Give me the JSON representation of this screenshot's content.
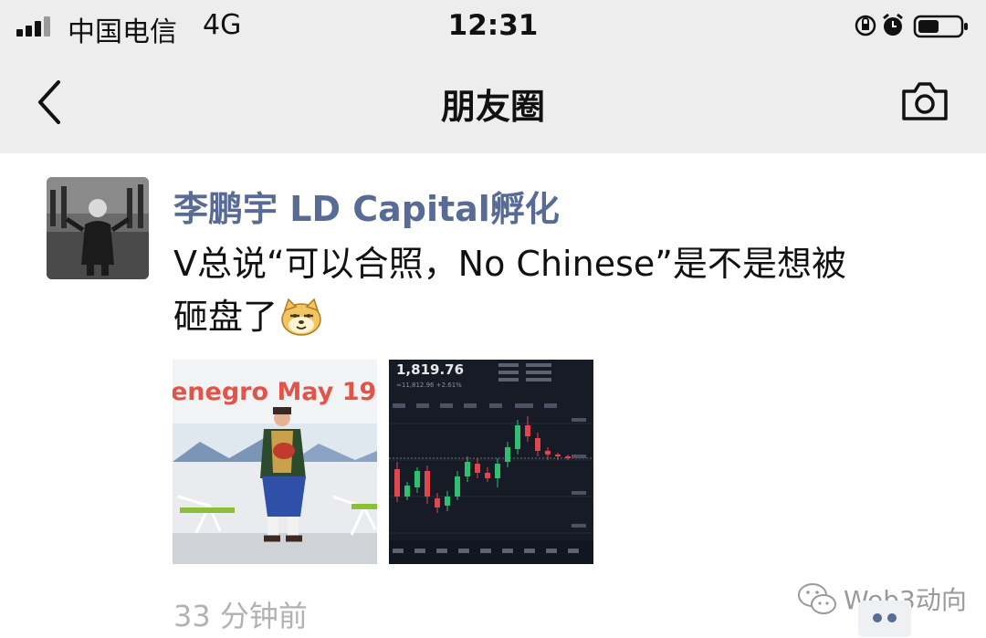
{
  "status_bar": {
    "carrier": "中国电信",
    "network": "4G",
    "time": "12:31",
    "icons": [
      "signal-icon",
      "orientation-lock-icon",
      "alarm-icon",
      "battery-icon"
    ]
  },
  "nav": {
    "title": "朋友圈",
    "back_icon": "chevron-left-icon",
    "camera_icon": "camera-icon"
  },
  "post": {
    "author": "李鹏宇 LD Capital孵化",
    "text_line1": "V总说“可以合照，No Chinese”是不是想被",
    "text_line2": "砸盘了",
    "emoji": "doge-emoji",
    "images": [
      {
        "caption_text": "enegro May 19",
        "alt": "performer-in-traditional-costume-photo"
      },
      {
        "alt": "eth-candlestick-chart-screenshot",
        "price": "1,819.76",
        "sub_price": "≈11,812.96 +2.61%"
      }
    ],
    "timestamp": "33 分钟前",
    "watermark": "Web3动向"
  },
  "colors": {
    "bar_bg": "#ededed",
    "author_name": "#576b95",
    "timestamp": "#b2b2b2",
    "candle_up": "#2fbf71",
    "candle_down": "#e0464e"
  }
}
